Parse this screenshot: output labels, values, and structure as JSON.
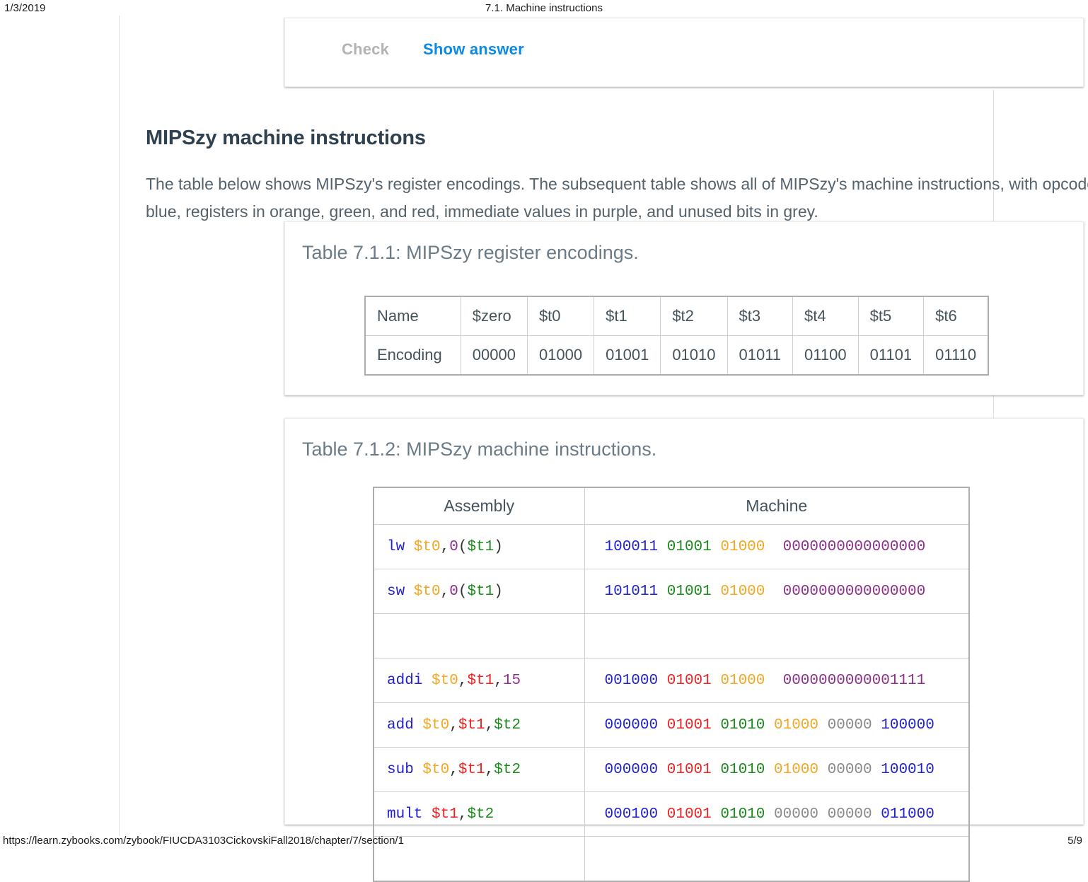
{
  "print_header": {
    "date": "1/3/2019",
    "title": "7.1. Machine instructions"
  },
  "print_footer": {
    "url": "https://learn.zybooks.com/zybook/FIUCDA3103CickovskiFall2018/chapter/7/section/1",
    "page": "5/9"
  },
  "activity": {
    "check_label": "Check",
    "show_answer_label": "Show answer"
  },
  "section": {
    "heading": "MIPSzy machine instructions",
    "paragraph": "The table below shows MIPSzy's register encodings. The subsequent table shows all of MIPSzy's machine instructions, with opcodes in blue, registers in orange, green, and red, immediate values in purple, and unused bits in grey."
  },
  "table_711": {
    "caption": "Table 7.1.1: MIPSzy register encodings.",
    "row_labels": [
      "Name",
      "Encoding"
    ],
    "names": [
      "$zero",
      "$t0",
      "$t1",
      "$t2",
      "$t3",
      "$t4",
      "$t5",
      "$t6"
    ],
    "encodings": [
      "00000",
      "01000",
      "01001",
      "01010",
      "01011",
      "01100",
      "01101",
      "01110"
    ]
  },
  "table_712": {
    "caption": "Table 7.1.2: MIPSzy machine instructions.",
    "headers": [
      "Assembly",
      "Machine"
    ],
    "rows": [
      {
        "assembly": [
          {
            "text": "lw ",
            "color": "blue"
          },
          {
            "text": "$t0",
            "color": "orange"
          },
          {
            "text": ",",
            "color": "black"
          },
          {
            "text": "0",
            "color": "purple"
          },
          {
            "text": "(",
            "color": "black"
          },
          {
            "text": "$t1",
            "color": "green"
          },
          {
            "text": ")",
            "color": "black"
          }
        ],
        "machine": [
          {
            "text": "100011",
            "color": "blue"
          },
          {
            "text": " ",
            "color": "black"
          },
          {
            "text": "01001",
            "color": "green"
          },
          {
            "text": " ",
            "color": "black"
          },
          {
            "text": "01000",
            "color": "orange"
          },
          {
            "text": "  ",
            "color": "black"
          },
          {
            "text": "0000000000000000",
            "color": "purple"
          }
        ]
      },
      {
        "assembly": [
          {
            "text": "sw ",
            "color": "blue"
          },
          {
            "text": "$t0",
            "color": "orange"
          },
          {
            "text": ",",
            "color": "black"
          },
          {
            "text": "0",
            "color": "purple"
          },
          {
            "text": "(",
            "color": "black"
          },
          {
            "text": "$t1",
            "color": "green"
          },
          {
            "text": ")",
            "color": "black"
          }
        ],
        "machine": [
          {
            "text": "101011",
            "color": "blue"
          },
          {
            "text": " ",
            "color": "black"
          },
          {
            "text": "01001",
            "color": "green"
          },
          {
            "text": " ",
            "color": "black"
          },
          {
            "text": "01000",
            "color": "orange"
          },
          {
            "text": "  ",
            "color": "black"
          },
          {
            "text": "0000000000000000",
            "color": "purple"
          }
        ]
      },
      {
        "assembly": [],
        "machine": [],
        "spacer": true
      },
      {
        "assembly": [
          {
            "text": "addi ",
            "color": "blue"
          },
          {
            "text": "$t0",
            "color": "orange"
          },
          {
            "text": ",",
            "color": "black"
          },
          {
            "text": "$t1",
            "color": "red"
          },
          {
            "text": ",",
            "color": "black"
          },
          {
            "text": "15",
            "color": "purple"
          }
        ],
        "machine": [
          {
            "text": "001000",
            "color": "blue"
          },
          {
            "text": " ",
            "color": "black"
          },
          {
            "text": "01001",
            "color": "red"
          },
          {
            "text": " ",
            "color": "black"
          },
          {
            "text": "01000",
            "color": "orange"
          },
          {
            "text": "  ",
            "color": "black"
          },
          {
            "text": "0000000000001111",
            "color": "purple"
          }
        ]
      },
      {
        "assembly": [
          {
            "text": "add ",
            "color": "blue"
          },
          {
            "text": "$t0",
            "color": "orange"
          },
          {
            "text": ",",
            "color": "black"
          },
          {
            "text": "$t1",
            "color": "red"
          },
          {
            "text": ",",
            "color": "black"
          },
          {
            "text": "$t2",
            "color": "green"
          }
        ],
        "machine": [
          {
            "text": "000000",
            "color": "blue"
          },
          {
            "text": " ",
            "color": "black"
          },
          {
            "text": "01001",
            "color": "red"
          },
          {
            "text": " ",
            "color": "black"
          },
          {
            "text": "01010",
            "color": "green"
          },
          {
            "text": " ",
            "color": "black"
          },
          {
            "text": "01000",
            "color": "orange"
          },
          {
            "text": " ",
            "color": "black"
          },
          {
            "text": "00000",
            "color": "grey"
          },
          {
            "text": " ",
            "color": "black"
          },
          {
            "text": "100000",
            "color": "blue"
          }
        ]
      },
      {
        "assembly": [
          {
            "text": "sub ",
            "color": "blue"
          },
          {
            "text": "$t0",
            "color": "orange"
          },
          {
            "text": ",",
            "color": "black"
          },
          {
            "text": "$t1",
            "color": "red"
          },
          {
            "text": ",",
            "color": "black"
          },
          {
            "text": "$t2",
            "color": "green"
          }
        ],
        "machine": [
          {
            "text": "000000",
            "color": "blue"
          },
          {
            "text": " ",
            "color": "black"
          },
          {
            "text": "01001",
            "color": "red"
          },
          {
            "text": " ",
            "color": "black"
          },
          {
            "text": "01010",
            "color": "green"
          },
          {
            "text": " ",
            "color": "black"
          },
          {
            "text": "01000",
            "color": "orange"
          },
          {
            "text": " ",
            "color": "black"
          },
          {
            "text": "00000",
            "color": "grey"
          },
          {
            "text": " ",
            "color": "black"
          },
          {
            "text": "100010",
            "color": "blue"
          }
        ]
      },
      {
        "assembly": [
          {
            "text": "mult ",
            "color": "blue"
          },
          {
            "text": "$t1",
            "color": "red"
          },
          {
            "text": ",",
            "color": "black"
          },
          {
            "text": "$t2",
            "color": "green"
          }
        ],
        "machine": [
          {
            "text": "000100",
            "color": "blue"
          },
          {
            "text": " ",
            "color": "black"
          },
          {
            "text": "01001",
            "color": "red"
          },
          {
            "text": " ",
            "color": "black"
          },
          {
            "text": "01010",
            "color": "green"
          },
          {
            "text": " ",
            "color": "black"
          },
          {
            "text": "00000",
            "color": "grey"
          },
          {
            "text": " ",
            "color": "black"
          },
          {
            "text": "00000",
            "color": "grey"
          },
          {
            "text": " ",
            "color": "black"
          },
          {
            "text": "011000",
            "color": "blue"
          }
        ]
      },
      {
        "assembly": [],
        "machine": [],
        "spacer": true
      }
    ]
  },
  "colors": {
    "opcode_blue": "#2222cc",
    "register_green": "#1a8a1a",
    "register_orange": "#f5a623",
    "register_red": "#ee2222",
    "immediate_purple": "#8e2f8e",
    "unused_grey": "#8a8a8a",
    "link_blue": "#0b8ae4",
    "disabled_grey": "#b3b3b3"
  }
}
